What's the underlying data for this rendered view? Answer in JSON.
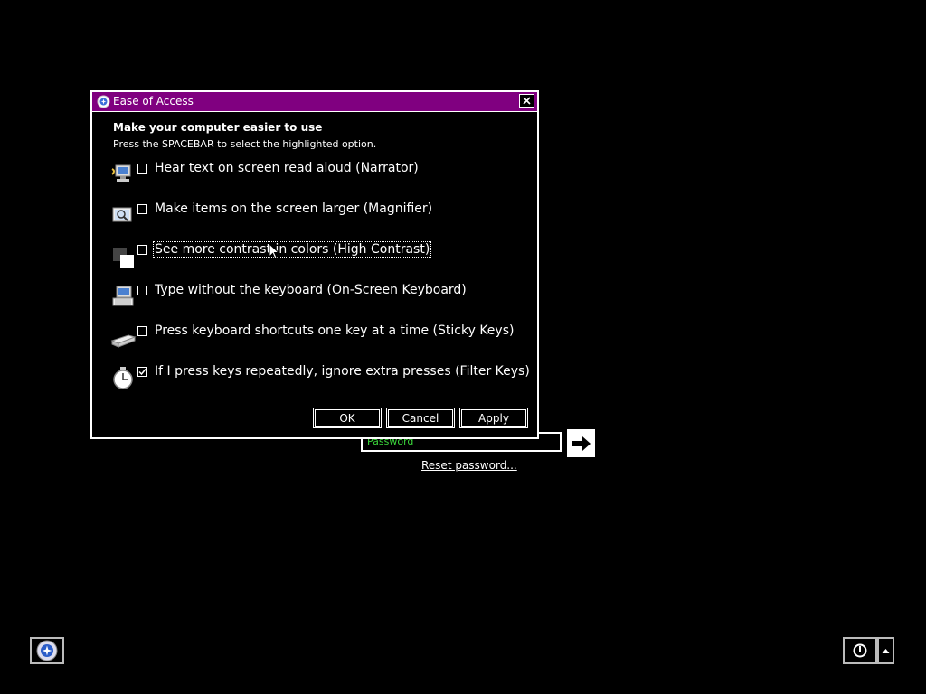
{
  "login": {
    "password_placeholder": "Password",
    "reset_link": "Reset password..."
  },
  "dialog": {
    "title": "Ease of Access",
    "heading": "Make your computer easier to use",
    "subheading": "Press the SPACEBAR to select the highlighted option.",
    "options": [
      {
        "label": "Hear text on screen read aloud (Narrator)",
        "checked": false,
        "icon": "narrator-icon"
      },
      {
        "label": "Make items on the screen larger (Magnifier)",
        "checked": false,
        "icon": "magnifier-icon"
      },
      {
        "label": "See more contrast in colors (High Contrast)",
        "checked": false,
        "icon": "high-contrast-icon"
      },
      {
        "label": "Type without the keyboard (On-Screen Keyboard)",
        "checked": false,
        "icon": "on-screen-keyboard-icon"
      },
      {
        "label": "Press keyboard shortcuts one key at a time (Sticky Keys)",
        "checked": false,
        "icon": "sticky-keys-icon"
      },
      {
        "label": "If I press keys repeatedly, ignore extra presses (Filter Keys)",
        "checked": true,
        "icon": "filter-keys-icon"
      }
    ],
    "buttons": {
      "ok": "OK",
      "cancel": "Cancel",
      "apply": "Apply"
    }
  },
  "colors": {
    "titlebar": "#800080",
    "placeholder": "#3bd83b"
  }
}
